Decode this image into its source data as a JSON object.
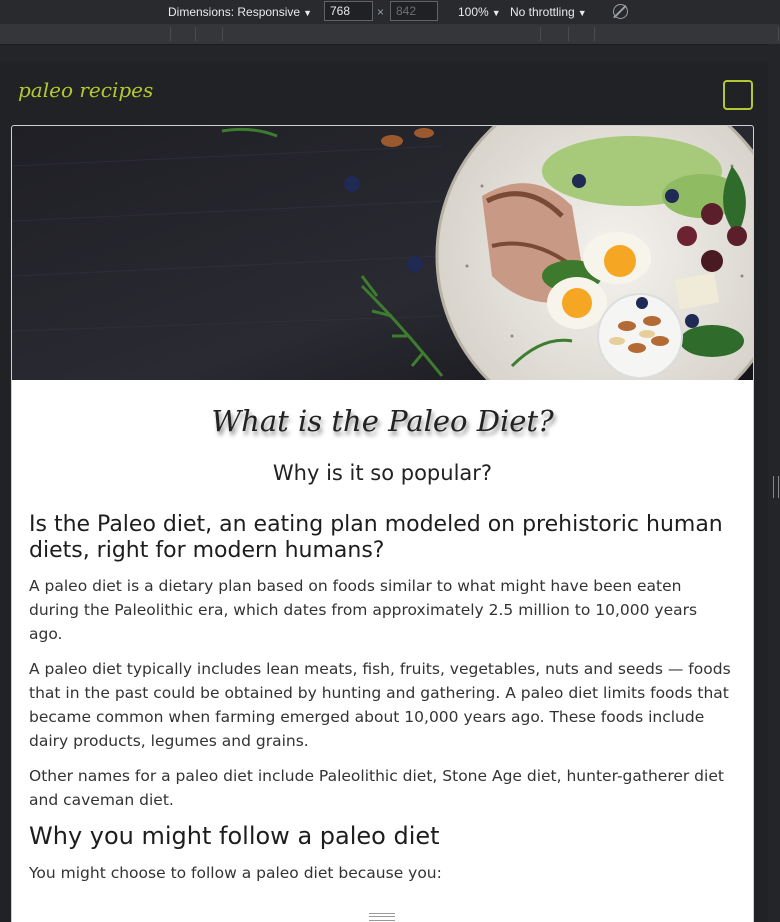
{
  "devtools": {
    "dimensions_label": "Dimensions: Responsive",
    "width_value": "768",
    "height_placeholder": "842",
    "times": "×",
    "zoom": "100%",
    "throttling": "No throttling"
  },
  "site": {
    "logo": "paleo recipes",
    "accent_color": "#b4c832"
  },
  "article": {
    "title": "What is the Paleo Diet?",
    "subtitle": "Why is it so popular?",
    "h2_1": "Is the Paleo diet, an eating plan modeled on prehistoric human diets, right for modern humans?",
    "p1": "A paleo diet is a dietary plan based on foods similar to what might have been eaten during the Paleolithic era, which dates from approximately 2.5 million to 10,000 years ago.",
    "p2": "A paleo diet typically includes lean meats, fish, fruits, vegetables, nuts and seeds — foods that in the past could be obtained by hunting and gathering. A paleo diet limits foods that became common when farming emerged about 10,000 years ago. These foods include dairy products, legumes and grains.",
    "p3": "Other names for a paleo diet include Paleolithic diet, Stone Age diet, hunter-gatherer diet and caveman diet.",
    "h2_2": "Why you might follow a paleo diet",
    "p4": "You might choose to follow a paleo diet because you:"
  }
}
